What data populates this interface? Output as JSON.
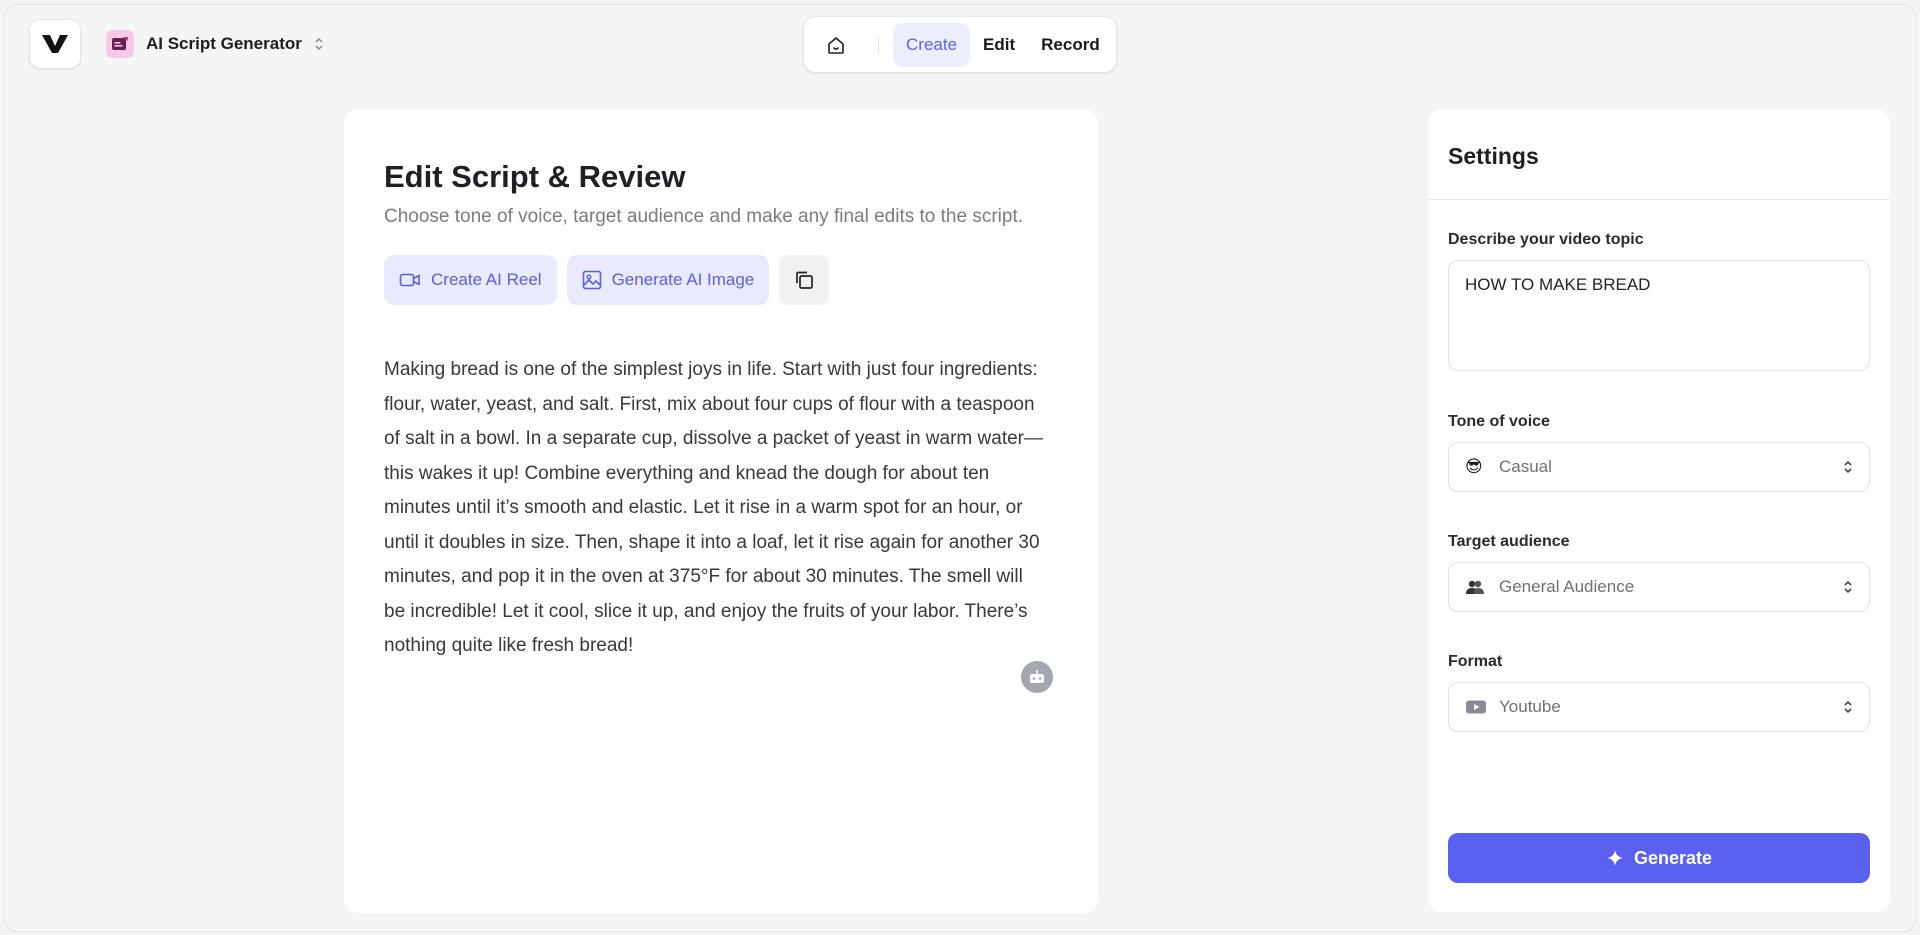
{
  "header": {
    "app_name": "AI Script Generator",
    "nav_tabs": [
      {
        "label": "Create",
        "active": true
      },
      {
        "label": "Edit",
        "active": false
      },
      {
        "label": "Record",
        "active": false
      }
    ]
  },
  "editor": {
    "title": "Edit Script & Review",
    "subtitle": "Choose tone of voice, target audience and make any final edits to the script.",
    "actions": {
      "create_reel": "Create AI Reel",
      "generate_image": "Generate AI Image"
    },
    "script": "Making bread is one of the simplest joys in life. Start with just four ingredients: flour, water, yeast, and salt. First, mix about four cups of flour with a teaspoon of salt in a bowl. In a separate cup, dissolve a packet of yeast in warm water—this wakes it up! Combine everything and knead the dough for about ten minutes until it’s smooth and elastic. Let it rise in a warm spot for an hour, or until it doubles in size. Then, shape it into a loaf, let it rise again for another 30 minutes, and pop it in the oven at 375°F for about 30 minutes. The smell will be incredible! Let it cool, slice it up, and enjoy the fruits of your labor. There’s nothing quite like fresh bread!"
  },
  "settings": {
    "title": "Settings",
    "topic_label": "Describe your video topic",
    "topic_value": "HOW TO MAKE BREAD",
    "tone_label": "Tone of voice",
    "tone_value": "Casual",
    "tone_emoji": "😎",
    "audience_label": "Target audience",
    "audience_value": "General Audience",
    "audience_emoji": "👥",
    "format_label": "Format",
    "format_value": "Youtube",
    "generate_label": "Generate"
  },
  "colors": {
    "accent": "#5a61f0",
    "accent_soft": "#e9eafd",
    "app_icon_bg": "#f7c9e8"
  }
}
